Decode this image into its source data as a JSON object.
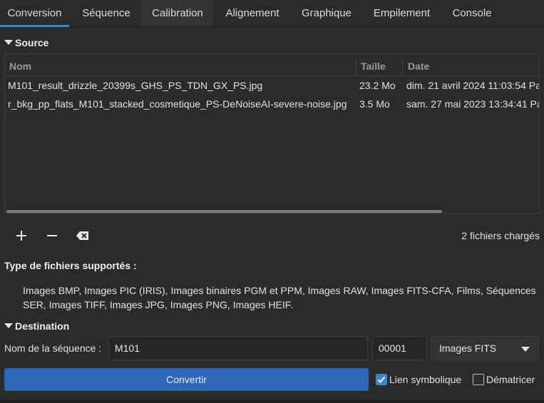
{
  "tabs": [
    "Conversion",
    "Séquence",
    "Calibration",
    "Alignement",
    "Graphique",
    "Empilement",
    "Console"
  ],
  "source": {
    "title": "Source",
    "columns": [
      "Nom",
      "Taille",
      "Date"
    ],
    "rows": [
      {
        "name": "M101_result_drizzle_20399s_GHS_PS_TDN_GX_PS.jpg",
        "size": "23.2 Mo",
        "date": "dim. 21 avril 2024 11:03:54 Pa"
      },
      {
        "name": "r_bkg_pp_flats_M101_stacked_cosmetique_PS-DeNoiseAI-severe-noise.jpg",
        "size": "3.5 Mo",
        "date": "sam. 27 mai 2023 13:34:41 Pa"
      }
    ],
    "count_text": "2 fichiers chargés",
    "icons": [
      "plus-icon",
      "minus-icon",
      "clear-icon"
    ]
  },
  "supported": {
    "title": "Type de fichiers supportés :",
    "text": "Images BMP, Images PIC (IRIS), Images binaires PGM et PPM, Images RAW, Images FITS-CFA, Films, Séquences SER, Images TIFF, Images JPG, Images PNG, Images HEIF."
  },
  "destination": {
    "title": "Destination",
    "sequence_label": "Nom de la séquence :",
    "sequence_name": "M101",
    "start_index": "00001",
    "output_type": "Images FITS",
    "convert_label": "Convertir",
    "symlink_label": "Lien symbolique",
    "symlink_checked": true,
    "debayer_label": "Dématricer",
    "debayer_checked": false
  },
  "colors": {
    "accent": "#3a86d0",
    "convert_button": "#2f66b6",
    "background": "#2b2b2b"
  }
}
